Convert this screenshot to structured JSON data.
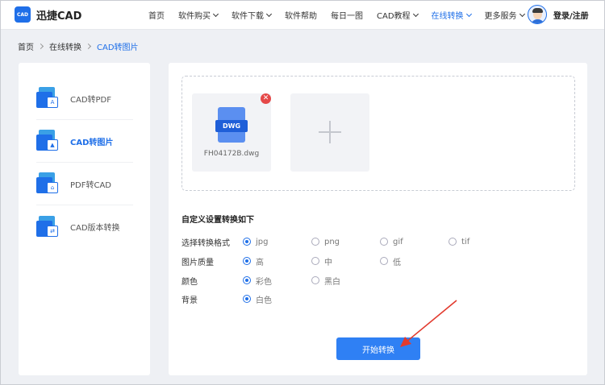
{
  "header": {
    "logo_mark": "CAD",
    "logo_text": "迅捷CAD",
    "nav": [
      {
        "label": "首页"
      },
      {
        "label": "软件购买"
      },
      {
        "label": "软件下载"
      },
      {
        "label": "软件帮助"
      },
      {
        "label": "每日一图"
      },
      {
        "label": "CAD教程"
      },
      {
        "label": "在线转换"
      },
      {
        "label": "更多服务"
      }
    ],
    "login": "登录/注册"
  },
  "breadcrumb": [
    "首页",
    "在线转换",
    "CAD转图片"
  ],
  "sidebar": {
    "items": [
      {
        "label": "CAD转PDF"
      },
      {
        "label": "CAD转图片"
      },
      {
        "label": "PDF转CAD"
      },
      {
        "label": "CAD版本转换"
      }
    ]
  },
  "upload": {
    "file_tag": "DWG",
    "file_name": "FH04172B.dwg"
  },
  "settings": {
    "title": "自定义设置转换如下",
    "rows": [
      {
        "label": "选择转换格式",
        "options": [
          "jpg",
          "png",
          "gif",
          "tif"
        ],
        "selected": "jpg"
      },
      {
        "label": "图片质量",
        "options": [
          "高",
          "中",
          "低"
        ],
        "selected": "高"
      },
      {
        "label": "颜色",
        "options": [
          "彩色",
          "黑白"
        ],
        "selected": "彩色"
      },
      {
        "label": "背景",
        "options": [
          "白色"
        ],
        "selected": "白色"
      }
    ]
  },
  "start_button": "开始转换",
  "colors": {
    "accent": "#1f6fe8",
    "button": "#2f80f4",
    "remove": "#e54848",
    "annotation_arrow": "#e23a2e"
  }
}
